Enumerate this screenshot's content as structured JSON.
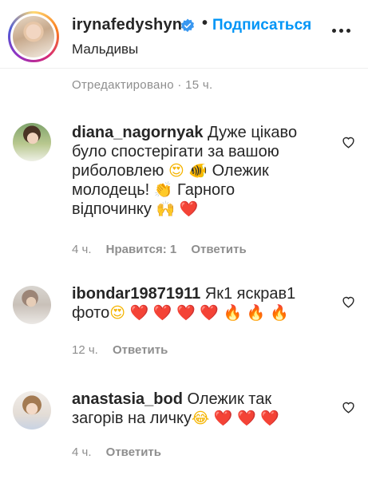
{
  "post": {
    "username": "irynafedyshyn",
    "follow_label": "Подписаться",
    "location": "Мальдивы",
    "edited_label": "Отредактировано · 15 ч."
  },
  "comments": [
    {
      "username": "diana_nagornyak",
      "lines": [
        "Дуже цікаво",
        "було спостерігати за вашою",
        "риболовлею",
        "Олежик",
        "молодець!",
        "Гарного",
        "відпочинку"
      ],
      "time": "4 ч.",
      "likes_label": "Нравится: 1",
      "reply_label": "Ответить"
    },
    {
      "username": "ibondar19871911",
      "lines": [
        "Як1 яскрав1",
        "фото"
      ],
      "time": "12 ч.",
      "reply_label": "Ответить"
    },
    {
      "username": "anastasia_bod",
      "lines": [
        "Олежик так",
        "загорів на личку"
      ],
      "time": "4 ч.",
      "reply_label": "Ответить"
    }
  ],
  "icons": {
    "verified": "verified-badge-icon",
    "more": "more-options-icon",
    "like": "heart-outline-icon",
    "emoji_heart_eyes": "😍",
    "emoji_fish": "🐠",
    "emoji_clap": "👏",
    "emoji_raised_hands": "🙌",
    "emoji_red_heart": "❤️",
    "emoji_fire": "🔥",
    "emoji_joy": "😂"
  },
  "colors": {
    "accent": "#0095f6",
    "text": "#262626",
    "muted": "#8e8e8e",
    "divider": "#efefef"
  }
}
